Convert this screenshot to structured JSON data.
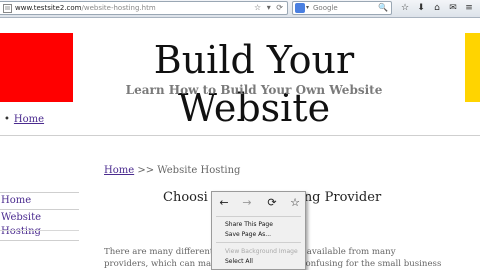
{
  "browser": {
    "url_domain": "www.testsite2.com",
    "url_path": "/website-hosting.htm",
    "url_icons": [
      "☆",
      "▾",
      "⟳"
    ],
    "search_placeholder": "Google",
    "search_engine_drop": "▾",
    "search_icon": "🔍",
    "toolbar_buttons": [
      "☆",
      "⬇",
      "⌂",
      "✉",
      "≡"
    ]
  },
  "header": {
    "title": "Build Your Website",
    "subtitle": "Learn How to Build Your Own Website"
  },
  "topnav": {
    "bullet": "•",
    "home": "Home"
  },
  "sidebar": {
    "items": [
      "Home",
      "Website Hosting"
    ]
  },
  "breadcrumb": {
    "home": "Home",
    "separator": ">>",
    "current": "Website Hosting"
  },
  "main": {
    "heading_left": "Choosi",
    "heading_right": "ng Provider",
    "paragraph": [
      "There are many different h",
      "providers, which can make"
    ],
    "paragraph_right": [
      "s available from many",
      "onfusing for the small business"
    ]
  },
  "context_menu": {
    "nav": [
      "←",
      "→",
      "⟳",
      "☆"
    ],
    "items": [
      "Share This Page",
      "Save Page As...",
      "View Background Image",
      "Select All"
    ]
  },
  "colors": {
    "red_block": "#ff0000",
    "yellow_block": "#ffd400",
    "link": "#4b2b8f",
    "subtitle": "#7a7a7a"
  }
}
